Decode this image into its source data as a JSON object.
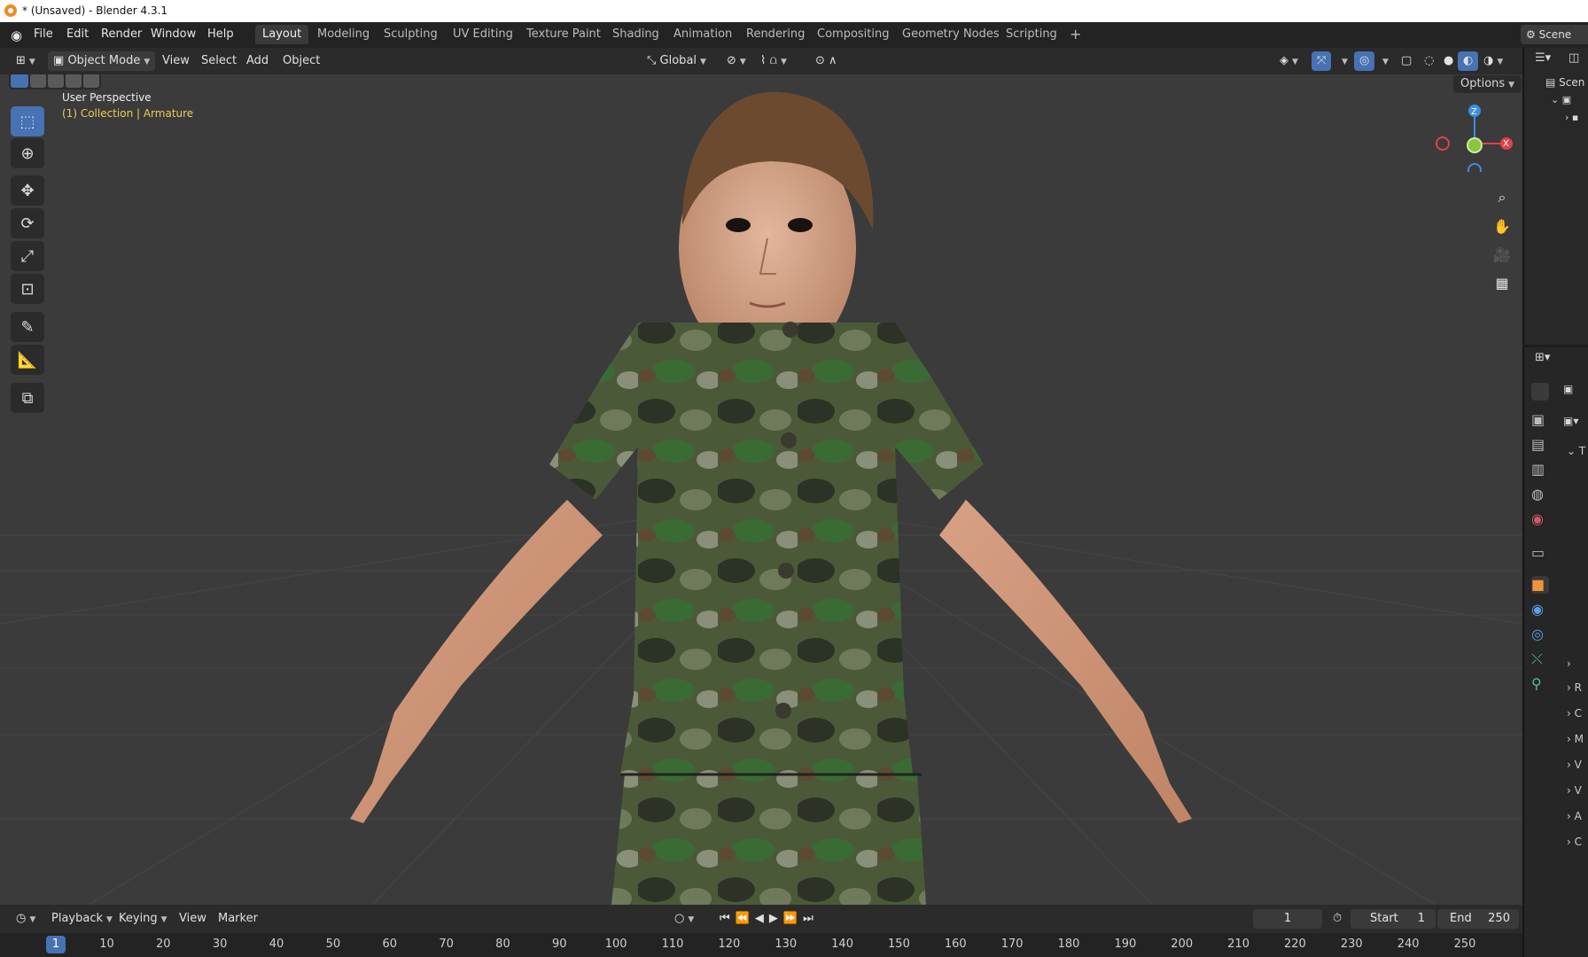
{
  "window": {
    "title": "* (Unsaved) - Blender 4.3.1"
  },
  "menubar": {
    "items": [
      "File",
      "Edit",
      "Render",
      "Window",
      "Help"
    ],
    "workspaces": [
      "Layout",
      "Modeling",
      "Sculpting",
      "UV Editing",
      "Texture Paint",
      "Shading",
      "Animation",
      "Rendering",
      "Compositing",
      "Geometry Nodes",
      "Scripting"
    ],
    "active_workspace": "Layout",
    "add_tab": "+",
    "scene_label": "Scene"
  },
  "viewport_header": {
    "mode": "Object Mode",
    "menus": [
      "View",
      "Select",
      "Add",
      "Object"
    ],
    "orientation": "Global",
    "options_label": "Options"
  },
  "viewport": {
    "perspective_label": "User Perspective",
    "collection_label": "(1) Collection | Armature",
    "gizmo": {
      "z": "Z",
      "x": "X"
    }
  },
  "timeline": {
    "menus": [
      "Playback",
      "Keying",
      "View",
      "Marker"
    ],
    "current_frame": "1",
    "start_label": "Start",
    "start_value": "1",
    "end_label": "End",
    "end_value": "250",
    "frame_marker": "1",
    "ruler": [
      "10",
      "20",
      "30",
      "40",
      "50",
      "60",
      "70",
      "80",
      "90",
      "100",
      "110",
      "120",
      "130",
      "140",
      "150",
      "160",
      "170",
      "180",
      "190",
      "200",
      "210",
      "220",
      "230",
      "240",
      "250"
    ]
  },
  "properties": {
    "rows": [
      "R",
      "C",
      "M",
      "V",
      "V",
      "A",
      "C"
    ],
    "top_label": "T"
  },
  "colors": {
    "accent": "#4772b3",
    "axis_x": "#e0424b",
    "axis_y": "#8bc53f",
    "axis_z": "#3d8de0",
    "collection_text": "#e6cf57"
  }
}
